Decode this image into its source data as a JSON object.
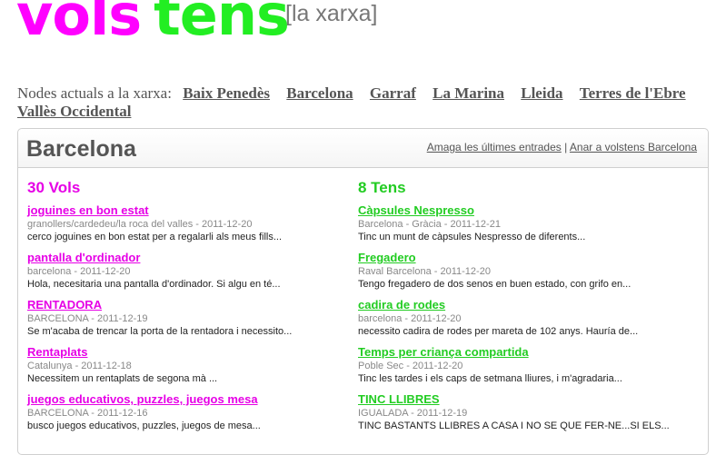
{
  "logo": {
    "vols": "vols",
    "tens": "tens"
  },
  "tagline": "[la xarxa]",
  "nodes": {
    "label": "Nodes actuals a la xarxa:",
    "items": [
      "Baix Penedès",
      "Barcelona",
      "Garraf",
      "La Marina",
      "Lleida",
      "Terres de l'Ebre",
      "Vallès Occidental"
    ]
  },
  "panel": {
    "title": "Barcelona",
    "link_hide": "Amaga les últimes entrades",
    "separator": "|",
    "link_go": "Anar a volstens Barcelona"
  },
  "vols": {
    "heading": "30 Vols",
    "entries": [
      {
        "title": "joguines en bon estat",
        "meta": "granollers/cardedeu/la roca del valles - 2011-12-20",
        "desc": "cerco joguines en bon estat per a regalarli als meus fills..."
      },
      {
        "title": "pantalla d'ordinador",
        "meta": "barcelona - 2011-12-20",
        "desc": "Hola, necesitaria una pantalla d'ordinador. Si algu en té..."
      },
      {
        "title": "RENTADORA",
        "meta": "BARCELONA - 2011-12-19",
        "desc": "Se m'acaba de trencar la porta de la rentadora i necessito..."
      },
      {
        "title": "Rentaplats",
        "meta": "Catalunya - 2011-12-18",
        "desc": "Necessitem un rentaplats de segona mà ..."
      },
      {
        "title": "juegos educativos, puzzles, juegos mesa",
        "meta": "BARCELONA - 2011-12-16",
        "desc": "busco juegos educativos, puzzles, juegos de mesa..."
      }
    ]
  },
  "tens": {
    "heading": "8 Tens",
    "entries": [
      {
        "title": "Càpsules Nespresso",
        "meta": "Barcelona - Gràcia - 2011-12-21",
        "desc": "Tinc un munt de càpsules Nespresso de diferents..."
      },
      {
        "title": "Fregadero",
        "meta": "Raval Barcelona - 2011-12-20",
        "desc": "Tengo fregadero de dos senos en buen estado, con grifo en..."
      },
      {
        "title": "cadira de rodes",
        "meta": "barcelona - 2011-12-20",
        "desc": "necessito cadira de rodes per mareta de 102 anys. Hauría de..."
      },
      {
        "title": "Temps per criança compartida",
        "meta": "Poble Sec - 2011-12-20",
        "desc": "Tinc les tardes i els caps de setmana lliures, i m'agradaria..."
      },
      {
        "title": "TINC LLIBRES",
        "meta": "IGUALADA - 2011-12-19",
        "desc": "TINC BASTANTS LLIBRES A CASA I NO SE QUE FER-NE...SI ELS..."
      }
    ]
  },
  "colors": {
    "vols": "#ff00ff",
    "tens": "#22ee22"
  }
}
